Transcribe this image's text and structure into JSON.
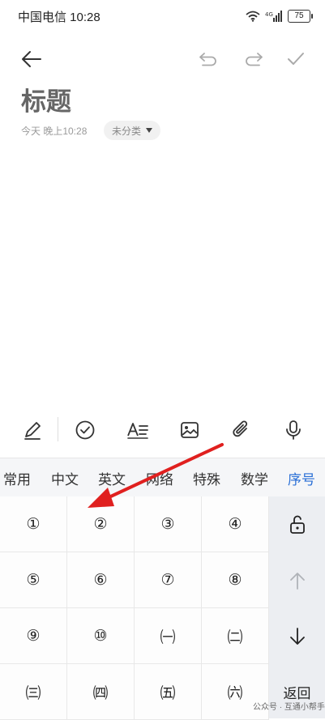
{
  "status_bar": {
    "carrier_time": "中国电信 10:28",
    "network": "4G",
    "battery": "75"
  },
  "note": {
    "title": "标题",
    "date": "今天 晚上10:28",
    "category": "未分类"
  },
  "keyboard": {
    "categories": [
      "常用",
      "中文",
      "英文",
      "网络",
      "特殊",
      "数学",
      "序号"
    ],
    "active_category": "序号",
    "keys": [
      "①",
      "②",
      "③",
      "④",
      "⑤",
      "⑥",
      "⑦",
      "⑧",
      "⑨",
      "⑩",
      "㈠",
      "㈡",
      "㈢",
      "㈣",
      "㈤",
      "㈥"
    ],
    "return_label": "返回"
  },
  "watermark": "公众号 · 互通小帮手",
  "colors": {
    "accent": "#2a6fd6",
    "annotation_arrow": "#e0201f"
  }
}
